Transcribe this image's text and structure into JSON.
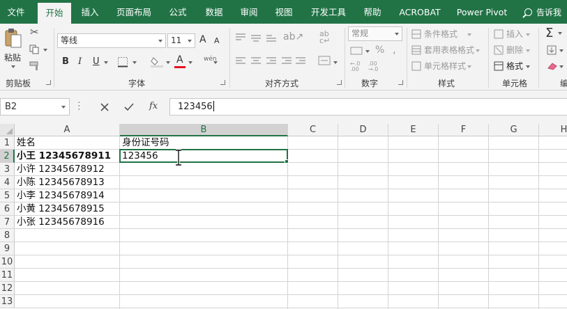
{
  "menu": {
    "tabs": [
      "文件",
      "开始",
      "插入",
      "页面布局",
      "公式",
      "数据",
      "审阅",
      "视图",
      "开发工具",
      "帮助",
      "ACROBAT",
      "Power Pivot"
    ],
    "active_tab": "开始",
    "tell_me": "告诉我"
  },
  "ribbon": {
    "clipboard": {
      "label": "剪贴板",
      "paste": "粘贴"
    },
    "font": {
      "label": "字体",
      "font_name": "等线",
      "font_size": "11",
      "bold": "B",
      "italic": "I",
      "underline": "U",
      "inc_size": "A",
      "dec_size": "A",
      "font_color": "A",
      "phonetic": "wén"
    },
    "alignment": {
      "label": "对齐方式"
    },
    "number": {
      "label": "数字",
      "format": "常规",
      "percent": "%"
    },
    "styles": {
      "label": "样式",
      "conditional": "条件格式",
      "table": "套用表格格式",
      "cell_styles": "单元格样式"
    },
    "cells": {
      "label": "单元格",
      "insert": "插入",
      "delete": "删除",
      "format": "格式"
    },
    "editing": {
      "label": "编"
    }
  },
  "formula_bar": {
    "name_box": "B2",
    "content": "123456",
    "fx": "fx"
  },
  "sheet": {
    "columns": [
      "A",
      "B",
      "C",
      "D",
      "E",
      "F",
      "G",
      "H"
    ],
    "rows": [
      "1",
      "2",
      "3",
      "4",
      "5",
      "6",
      "7",
      "8",
      "9",
      "10",
      "11",
      "12",
      "13"
    ],
    "selected_column": "B",
    "selected_row": "2",
    "active_cell": "B2",
    "cells": {
      "A1": "姓名",
      "B1": "身份证号码",
      "A2": "小王 12345678911",
      "B2": "123456",
      "A3": "小许 12345678912",
      "A4": "小陈 12345678913",
      "A5": "小李 12345678914",
      "A6": "小黄 12345678915",
      "A7": "小张 12345678916"
    }
  },
  "colors": {
    "accent": "#217346",
    "ribbon_bg": "#f3f3f3",
    "grid_line": "#d4d4d4",
    "font_red": "#e81123"
  }
}
